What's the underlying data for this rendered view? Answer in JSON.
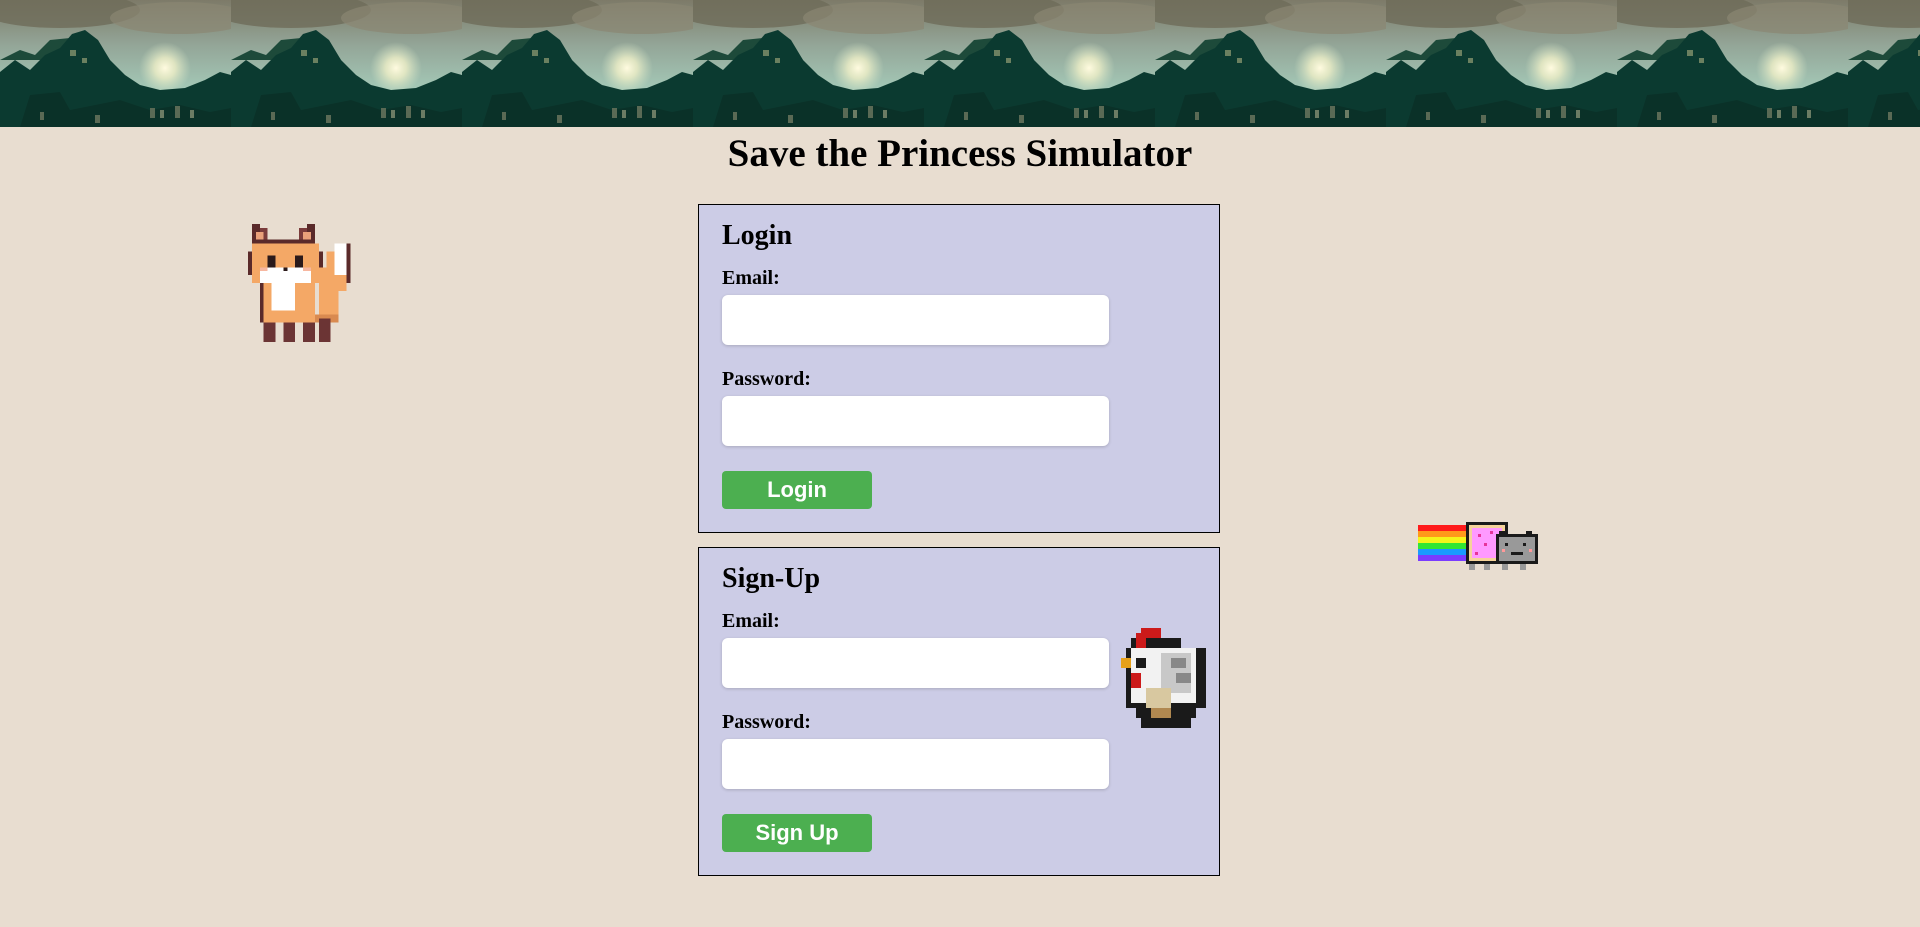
{
  "page": {
    "title": "Save the Princess Simulator",
    "background_color": "#e8ddd0"
  },
  "banner": {
    "image": "forest-ruins-banner"
  },
  "login": {
    "heading": "Login",
    "email_label": "Email:",
    "email_value": "",
    "password_label": "Password:",
    "password_value": "",
    "button_label": "Login"
  },
  "signup": {
    "heading": "Sign-Up",
    "email_label": "Email:",
    "email_value": "",
    "password_label": "Password:",
    "password_value": "",
    "button_label": "Sign Up"
  },
  "sprites": {
    "fox": "fox-sprite",
    "nyan_cat": "nyan-cat-sprite",
    "chicken": "chicken-sprite"
  },
  "colors": {
    "panel_bg": "#cccce6",
    "button_green": "#4caf50"
  }
}
